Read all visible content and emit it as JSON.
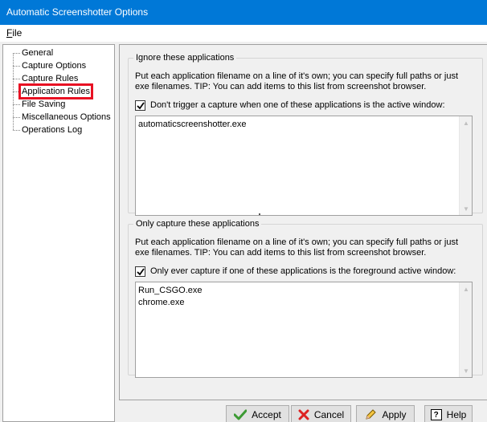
{
  "window": {
    "title": "Automatic Screenshotter Options"
  },
  "menu": {
    "file_accel": "F",
    "file_rest": "ile"
  },
  "tree": {
    "items": [
      {
        "label": "General"
      },
      {
        "label": "Capture Options"
      },
      {
        "label": "Capture Rules"
      },
      {
        "label": "Application Rules",
        "selected": true
      },
      {
        "label": "File Saving"
      },
      {
        "label": "Miscellaneous Options"
      },
      {
        "label": "Operations Log"
      }
    ]
  },
  "ignore_group": {
    "title": "Ignore these applications",
    "help": "Put each application filename on a line of it's own; you can specify full paths or just exe filenames. TIP: You can add items to this list from screenshot browser.",
    "checkbox_label": "Don't trigger a capture when one of these applications is the active window:",
    "checked": true,
    "entries": [
      "automaticscreenshotter.exe"
    ]
  },
  "only_group": {
    "title": "Only capture these applications",
    "help": "Put each application filename on a line of it's own; you can specify full paths or just exe filenames. TIP: You can add items to this list from screenshot browser.",
    "checkbox_label": "Only ever capture if one of these applications is the foreground active window:",
    "checked": true,
    "entries": [
      "Run_CSGO.exe",
      "chrome.exe"
    ]
  },
  "buttons": {
    "accept": "Accept",
    "cancel": "Cancel",
    "apply": "Apply",
    "help": "Help",
    "help_icon_glyph": "?"
  },
  "colors": {
    "titlebar": "#0078d7",
    "highlight": "#e81123"
  }
}
